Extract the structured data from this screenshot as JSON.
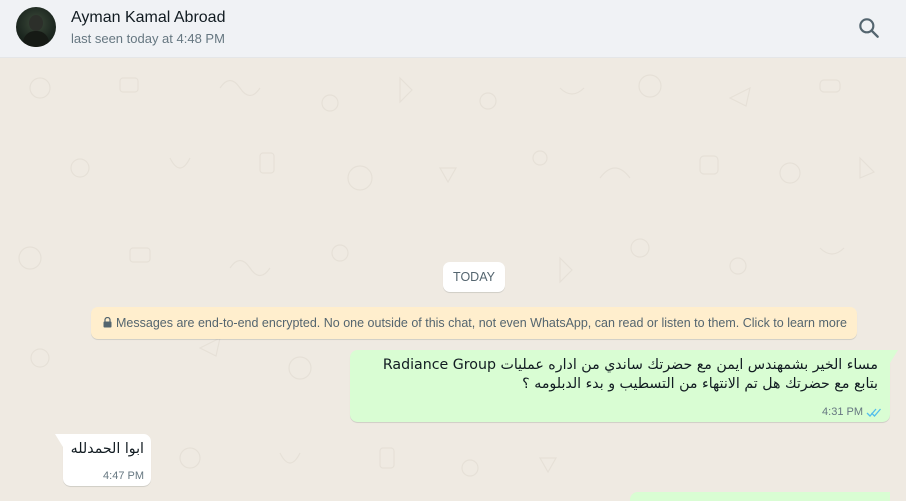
{
  "header": {
    "contact_name": "Ayman Kamal Abroad",
    "last_seen": "last seen today at 4:48 PM",
    "avatar_icon": "contact-photo",
    "search_icon": "search-icon"
  },
  "chat": {
    "date_badge": "TODAY",
    "encryption_notice": "Messages are end-to-end encrypted. No one outside of this chat, not even WhatsApp, can read or listen to them. Click to learn more",
    "messages": [
      {
        "direction": "outgoing",
        "line1": "مساء الخير بشمهندس ايمن مع حضرتك ساندي من اداره عمليات Radiance Group",
        "line2": "بتابع مع حضرتك هل تم الانتهاء من التسطيب و بدء الدبلومه ؟",
        "time": "4:31 PM",
        "status": "read"
      },
      {
        "direction": "incoming",
        "text": "ابوا الحمدلله",
        "time": "4:47 PM"
      }
    ]
  },
  "colors": {
    "outgoing_bubble": "#d9fdd3",
    "incoming_bubble": "#ffffff",
    "chat_background": "#efeae2",
    "notice_background": "#ffeecd",
    "read_ticks": "#53bdeb"
  }
}
